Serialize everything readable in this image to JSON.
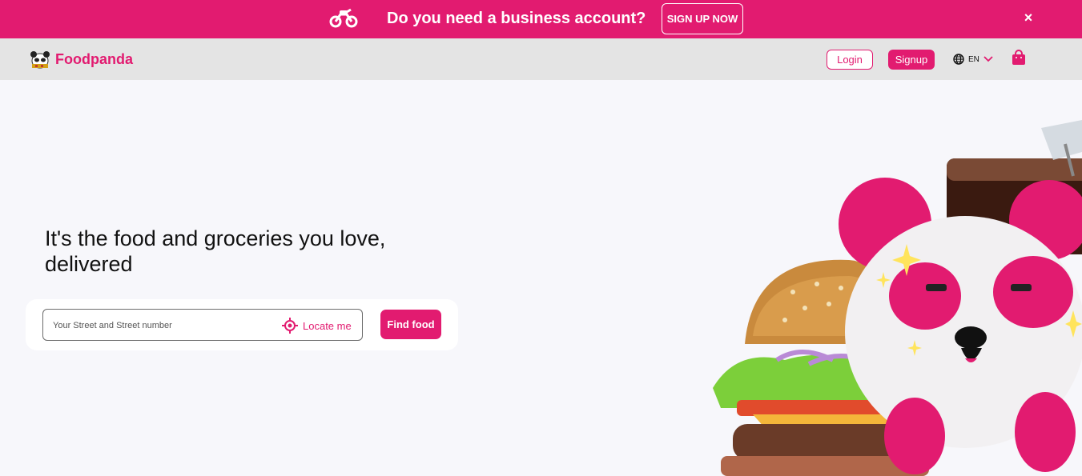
{
  "promo": {
    "message": "Do you need a business account?",
    "cta_label": "SIGN UP NOW",
    "close_label": "×",
    "icon": "motorbike-icon"
  },
  "header": {
    "brand": "Foodpanda",
    "login_label": "Login",
    "signup_label": "Signup",
    "language": "EN",
    "icons": [
      "panda-logo-icon",
      "globe-icon",
      "chevron-down-icon",
      "shopping-bag-icon"
    ]
  },
  "hero": {
    "headline_line1": "It's the food and groceries you love,",
    "headline_line2": "delivered",
    "search_placeholder": "Your Street and Street number",
    "locate_label": "Locate me",
    "find_label": "Find food"
  },
  "colors": {
    "brand": "#e21b70",
    "header_bg": "#e4e4e4",
    "page_bg": "#f7f7fb"
  }
}
